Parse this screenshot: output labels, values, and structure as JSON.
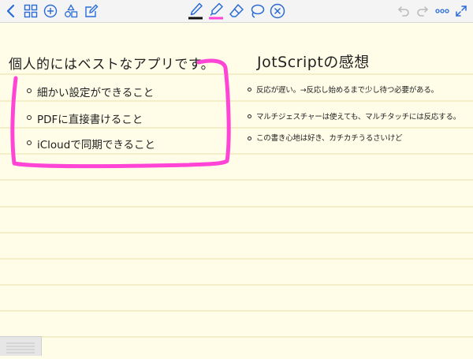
{
  "toolbar": {
    "left_tools": [
      "back-icon",
      "grid-icon",
      "add-icon",
      "shapes-icon",
      "edit-icon"
    ],
    "center_tools": [
      "pen-icon",
      "highlighter-icon",
      "eraser-icon",
      "lasso-icon",
      "close-circle-icon"
    ],
    "right_tools": [
      "undo-icon",
      "redo-icon",
      "more-icon",
      "expand-icon"
    ],
    "pen_color": "#111111",
    "highlighter_color": "#ff44d6",
    "accent_color": "#2a6bd6"
  },
  "note": {
    "left_title": "個人的にはベストなアプリです。",
    "left_items": [
      "細かい設定ができること",
      "PDFに直接書けること",
      "iCloudで同期できること"
    ],
    "right_title": "JotScriptの感想",
    "right_items": [
      "反応が遅い。→反応し始めるまで少し待つ必要がある。",
      "マルチジェスチャーは使えても、マルチタッチには反応する。",
      "この書き心地は好き、カチカチうるさいけど"
    ],
    "highlight_color": "#ff44d6",
    "ruled_line_color": "#e8dfa8",
    "paper_color": "#fffde8"
  }
}
